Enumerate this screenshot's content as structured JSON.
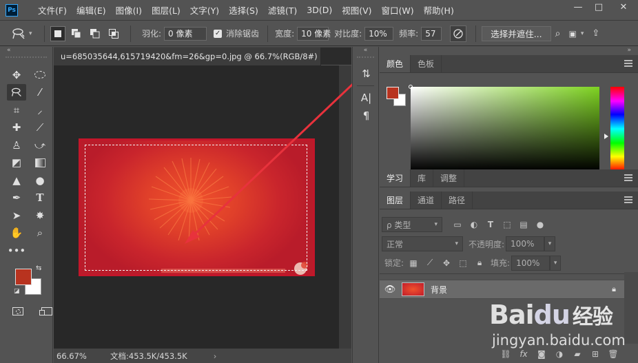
{
  "app": {
    "logo_text": "Ps"
  },
  "menu": [
    "文件(F)",
    "编辑(E)",
    "图像(I)",
    "图层(L)",
    "文字(Y)",
    "选择(S)",
    "滤镜(T)",
    "3D(D)",
    "视图(V)",
    "窗口(W)",
    "帮助(H)"
  ],
  "window_controls": {
    "minimize": "—",
    "restore": "□",
    "close": "✕"
  },
  "options": {
    "feather_label": "羽化:",
    "feather_value": "0 像素",
    "antialias_label": "消除锯齿",
    "width_label": "宽度:",
    "width_value": "10 像素",
    "contrast_label": "对比度:",
    "contrast_value": "10%",
    "frequency_label": "频率:",
    "frequency_value": "57",
    "select_mask_label": "选择并遮住..."
  },
  "document": {
    "tab_title": "u=685035644,615719420&fm=26&gp=0.jpg @ 66.7%(RGB/8#)",
    "tab_close": "×",
    "zoom": "66.67%",
    "doc_info": "文档:453.5K/453.5K",
    "status_arrow": "›"
  },
  "panels": {
    "color_tabs": [
      "颜色",
      "色板"
    ],
    "learn_tabs": [
      "学习",
      "库",
      "调整"
    ],
    "layers_tabs": [
      "图层",
      "通道",
      "路径"
    ],
    "kind_filter": "ρ 类型",
    "blend_mode": "正常",
    "opacity_label": "不透明度:",
    "opacity_value": "100%",
    "lock_label": "锁定:",
    "fill_label": "填充:",
    "fill_value": "100%",
    "layer_name": "背景"
  },
  "colors": {
    "foreground": "#b8331f",
    "background": "#ffffff",
    "accent": "#31a8ff"
  },
  "watermark": {
    "logo_a": "Bai",
    "logo_b": "du",
    "logo_cn": "经验",
    "url": "jingyan.baidu.com"
  }
}
